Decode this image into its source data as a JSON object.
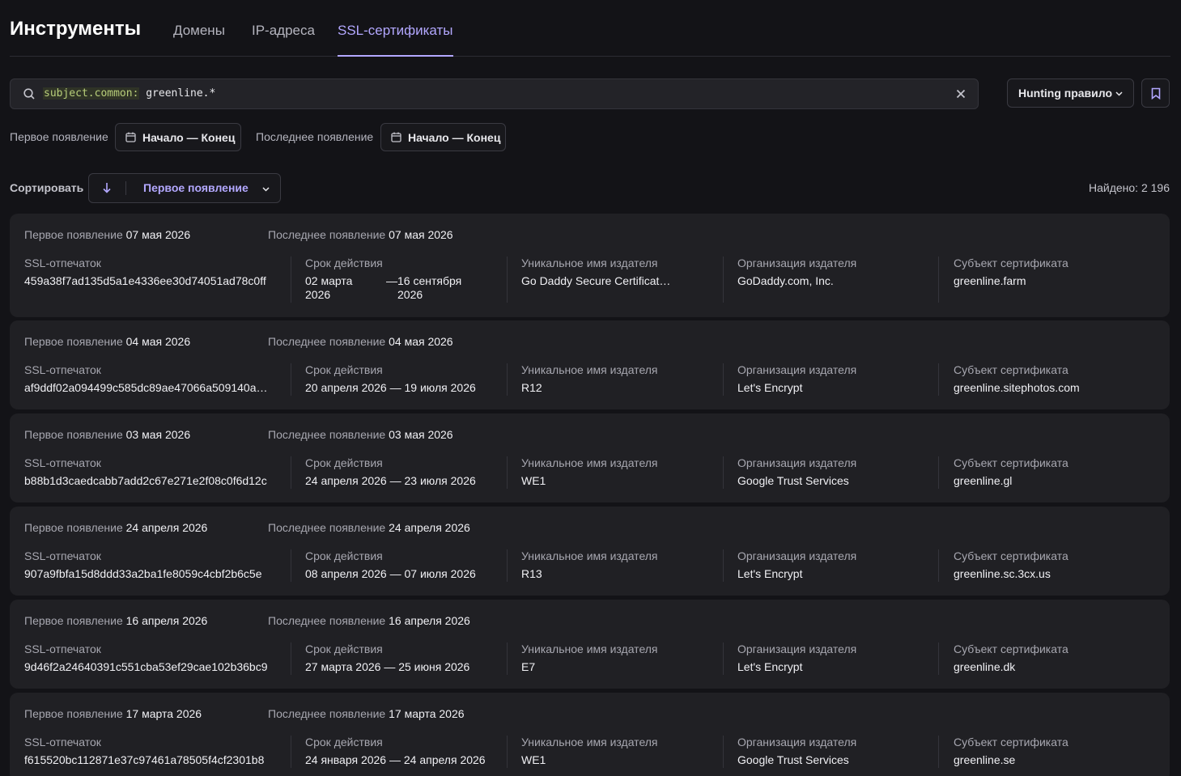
{
  "header": {
    "title": "Инструменты",
    "tabs": [
      {
        "label": "Домены",
        "active": false
      },
      {
        "label": "IP-адреса",
        "active": false
      },
      {
        "label": "SSL-сертификаты",
        "active": true
      }
    ]
  },
  "search": {
    "query_key": "subject.common:",
    "query_value": "greenline.*"
  },
  "hunting": {
    "label": "Hunting правило"
  },
  "filters": {
    "first_label": "Первое появление",
    "first_range": "Начало — Конец",
    "last_label": "Последнее появление",
    "last_range": "Начало — Конец"
  },
  "sort": {
    "label": "Сортировать",
    "direction": "descending",
    "field": "Первое появление"
  },
  "found": "Найдено: 2 196",
  "columns": {
    "first_seen": "Первое появление",
    "last_seen": "Последнее появление",
    "fingerprint": "SSL-отпечаток",
    "validity": "Срок действия",
    "issuer_cn": "Уникальное имя издателя",
    "issuer_org": "Организация издателя",
    "subject": "Субъект сертификата"
  },
  "certificates": [
    {
      "first_seen": "07 мая 2026",
      "last_seen": "07 мая 2026",
      "fingerprint": "459a38f7ad135d5a1e4336ee30d74051ad78c0ff",
      "valid_from": "02 марта 2026",
      "valid_to": "16 сентября 2026",
      "issuer_cn": "Go Daddy Secure Certificate…",
      "issuer_org": "GoDaddy.com, Inc.",
      "subject": "greenline.farm"
    },
    {
      "first_seen": "04 мая 2026",
      "last_seen": "04 мая 2026",
      "fingerprint": "af9ddf02a094499c585dc89ae47066a509140a…",
      "valid_from": "20 апреля 2026",
      "valid_to": "19 июля 2026",
      "issuer_cn": "R12",
      "issuer_org": "Let's Encrypt",
      "subject": "greenline.sitephotos.com"
    },
    {
      "first_seen": "03 мая 2026",
      "last_seen": "03 мая 2026",
      "fingerprint": "b88b1d3caedcabb7add2c67e271e2f08c0f6d12c",
      "valid_from": "24 апреля 2026",
      "valid_to": "23 июля 2026",
      "issuer_cn": "WE1",
      "issuer_org": "Google Trust Services",
      "subject": "greenline.gl"
    },
    {
      "first_seen": "24 апреля 2026",
      "last_seen": "24 апреля 2026",
      "fingerprint": "907a9fbfa15d8ddd33a2ba1fe8059c4cbf2b6c5e",
      "valid_from": "08 апреля 2026",
      "valid_to": "07 июля 2026",
      "issuer_cn": "R13",
      "issuer_org": "Let's Encrypt",
      "subject": "greenline.sc.3cx.us"
    },
    {
      "first_seen": "16 апреля 2026",
      "last_seen": "16 апреля 2026",
      "fingerprint": "9d46f2a24640391c551cba53ef29cae102b36bc9",
      "valid_from": "27 марта 2026",
      "valid_to": "25 июня 2026",
      "issuer_cn": "E7",
      "issuer_org": "Let's Encrypt",
      "subject": "greenline.dk"
    },
    {
      "first_seen": "17 марта 2026",
      "last_seen": "17 марта 2026",
      "fingerprint": "f615520bc112871e37c97461a78505f4cf2301b8",
      "valid_from": "24 января 2026",
      "valid_to": "24 апреля 2026",
      "issuer_cn": "WE1",
      "issuer_org": "Google Trust Services",
      "subject": "greenline.se"
    }
  ]
}
